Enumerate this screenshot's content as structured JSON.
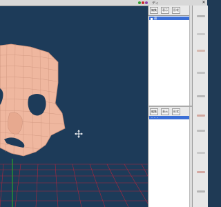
{
  "toolbar": {
    "label": "ディ",
    "close_glyph": "✕"
  },
  "panel_top": {
    "tabs": [
      "編集",
      "表示",
      "形状"
    ],
    "selected_row_label": "顔"
  },
  "panel_bottom": {
    "tabs": [
      "編集",
      "表示",
      "形状"
    ],
    "selected_row_label": "・・・"
  },
  "colors": {
    "viewport_bg": "#1d3b59",
    "mesh_fill": "#efb79f",
    "mesh_line": "#c98f79",
    "grid_line": "#c8243a",
    "axis_green": "#2aa32a",
    "selection_blue": "#3b6fd6"
  },
  "icons": [
    "cursor-move-icon"
  ]
}
